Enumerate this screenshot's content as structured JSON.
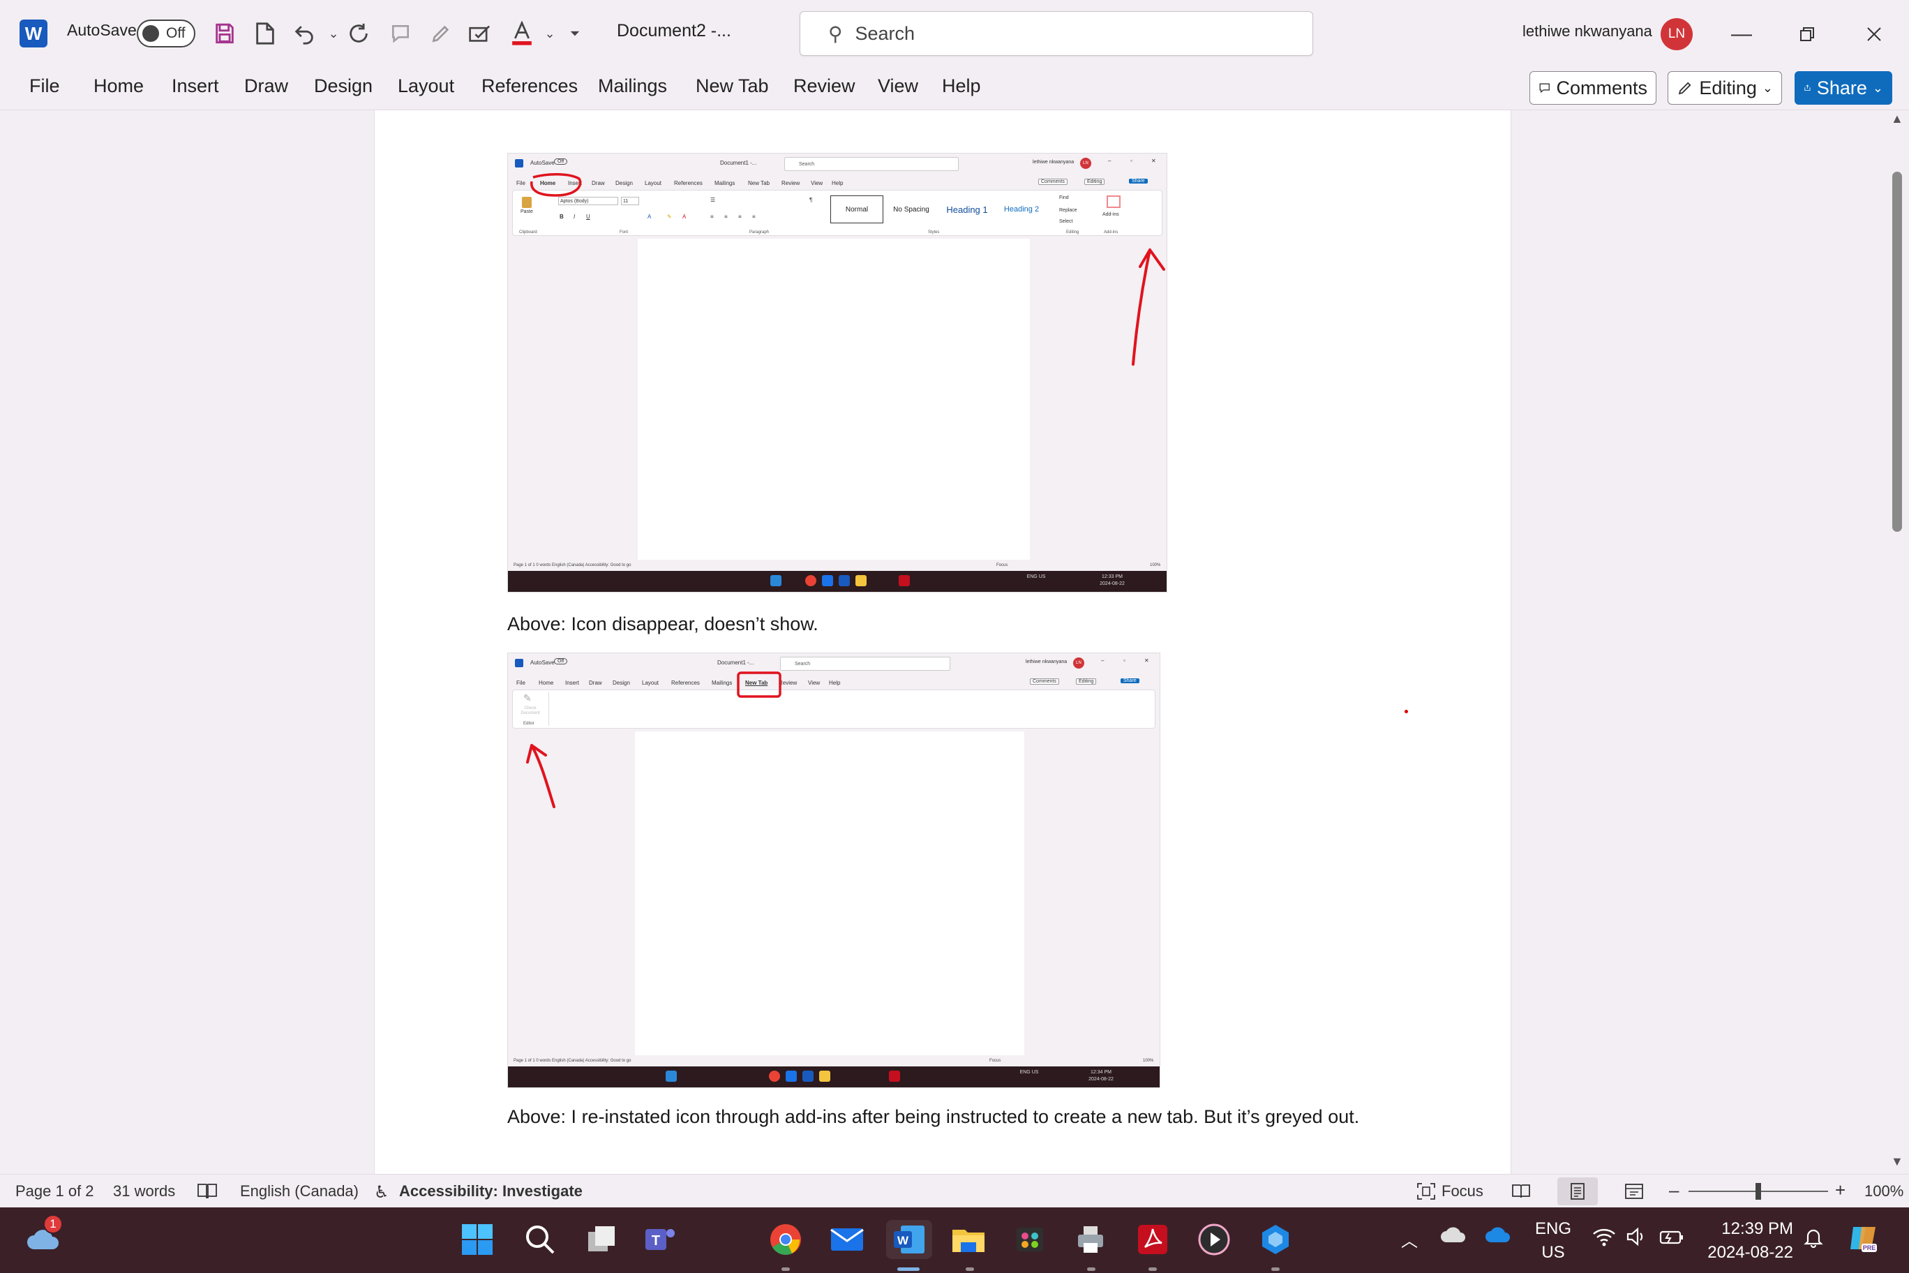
{
  "app": {
    "autosave_label": "AutoSave",
    "autosave_state": "Off",
    "doc_title": "Document2  -...",
    "search_placeholder": "Search",
    "user_name": "lethiwe nkwanyana",
    "user_initials": "LN"
  },
  "menu": {
    "items": [
      "File",
      "Home",
      "Insert",
      "Draw",
      "Design",
      "Layout",
      "References",
      "Mailings",
      "New Tab",
      "Review",
      "View",
      "Help"
    ],
    "comments_label": "Comments",
    "editing_label": "Editing",
    "share_label": "Share"
  },
  "document": {
    "caption1": "Above: Icon disappear, doesn’t show.",
    "caption2": "Above: I re-instated icon through add-ins after being instructed to create a new tab. But it’s greyed out.",
    "shot1": {
      "autosave": "AutoSave",
      "off": "Off",
      "title": "Document1 -...",
      "search": "Search",
      "user": "lethiwe nkwanyana",
      "initials": "LN",
      "menu": [
        "File",
        "Home",
        "Insert",
        "Draw",
        "Design",
        "Layout",
        "References",
        "Mailings",
        "New Tab",
        "Review",
        "View",
        "Help"
      ],
      "comments": "Comments",
      "editing": "Editing",
      "share": "Share",
      "font_name": "Aptos (Body)",
      "font_size": "11",
      "styles": [
        "Normal",
        "No Spacing",
        "Heading 1",
        "Heading 2"
      ],
      "editing_items": [
        "Find",
        "Replace",
        "Select"
      ],
      "addins": "Add-ins",
      "groups": [
        "Clipboard",
        "Font",
        "Paragraph",
        "Styles",
        "Editing",
        "Add-ins"
      ],
      "paste": "Paste",
      "status": "Page 1 of 1    0 words      English (Canada)    Accessibility: Good to go",
      "focus": "Focus",
      "zoom": "100%",
      "lang": "ENG US",
      "time": "12:33 PM",
      "date": "2024-08-22"
    },
    "shot2": {
      "autosave": "AutoSave",
      "off": "Off",
      "title": "Document1 -...",
      "search": "Search",
      "user": "lethiwe nkwanyana",
      "initials": "LN",
      "menu": [
        "File",
        "Home",
        "Insert",
        "Draw",
        "Design",
        "Layout",
        "References",
        "Mailings",
        "New Tab",
        "Review",
        "View",
        "Help"
      ],
      "comments": "Comments",
      "editing": "Editing",
      "share": "Share",
      "check_doc": "Check Document",
      "editor_group": "Editor",
      "status": "Page 1 of 1    0 words      English (Canada)    Accessibility: Good to go",
      "focus": "Focus",
      "zoom": "100%",
      "lang": "ENG US",
      "time": "12:34 PM",
      "date": "2024-08-22"
    }
  },
  "status": {
    "page": "Page 1 of 2",
    "words": "31 words",
    "language": "English (Canada)",
    "accessibility": "Accessibility: Investigate",
    "focus": "Focus",
    "zoom": "100%"
  },
  "taskbar": {
    "notification_count": "1",
    "lang_line1": "ENG",
    "lang_line2": "US",
    "time": "12:39 PM",
    "date": "2024-08-22"
  },
  "colors": {
    "accent": "#0f6cbd",
    "word_blue": "#185abd",
    "avatar_red": "#d13438",
    "annotation_red": "#e0141e",
    "taskbar": "#3b2127"
  }
}
